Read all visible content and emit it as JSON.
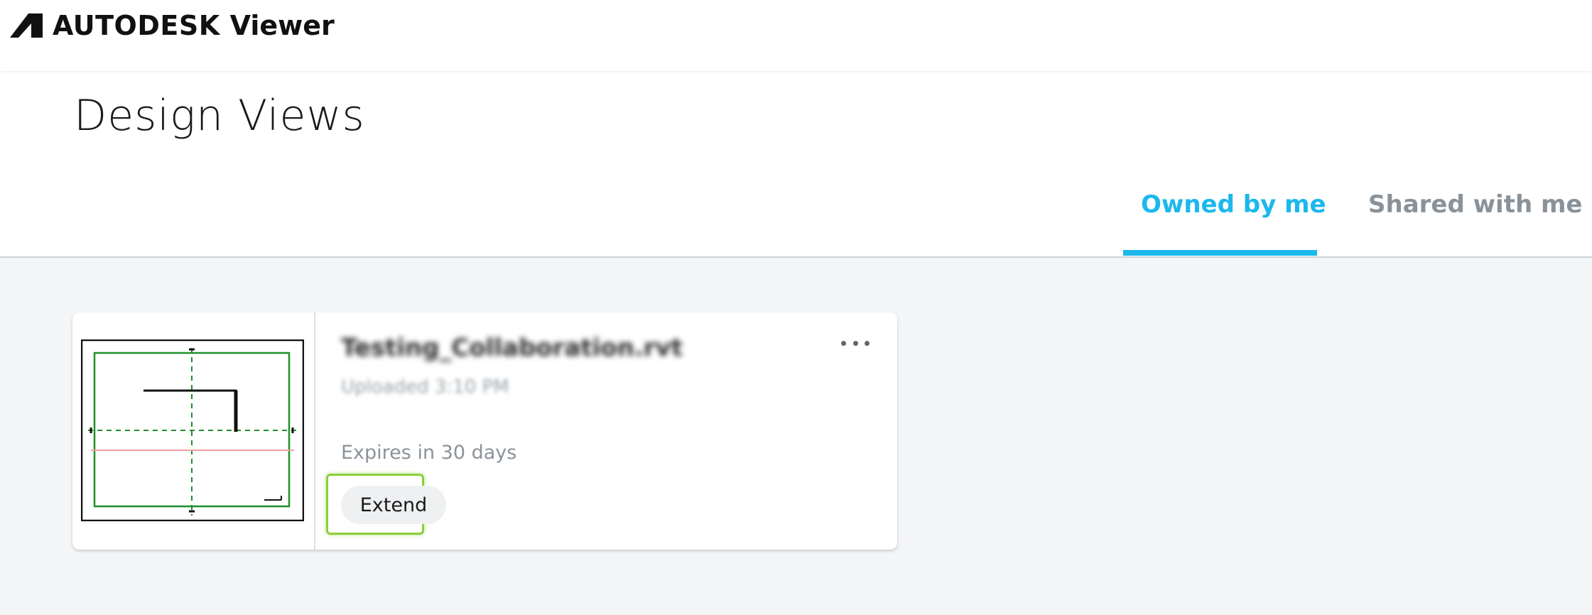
{
  "app": {
    "brand": "AUTODESK",
    "product": "Viewer"
  },
  "page": {
    "title": "Design Views"
  },
  "tabs": [
    {
      "label": "Owned by me",
      "active": true
    },
    {
      "label": "Shared with me",
      "active": false
    }
  ],
  "card": {
    "file_name": "Testing_Collaboration.rvt",
    "uploaded": "Uploaded 3:10 PM",
    "expires": "Expires in 30 days",
    "extend_label": "Extend",
    "menu_icon": "more-horizontal-icon"
  },
  "colors": {
    "accent": "#1bb8ec",
    "highlight": "#8ccf3a",
    "drawing_green": "#1f8f2a"
  }
}
